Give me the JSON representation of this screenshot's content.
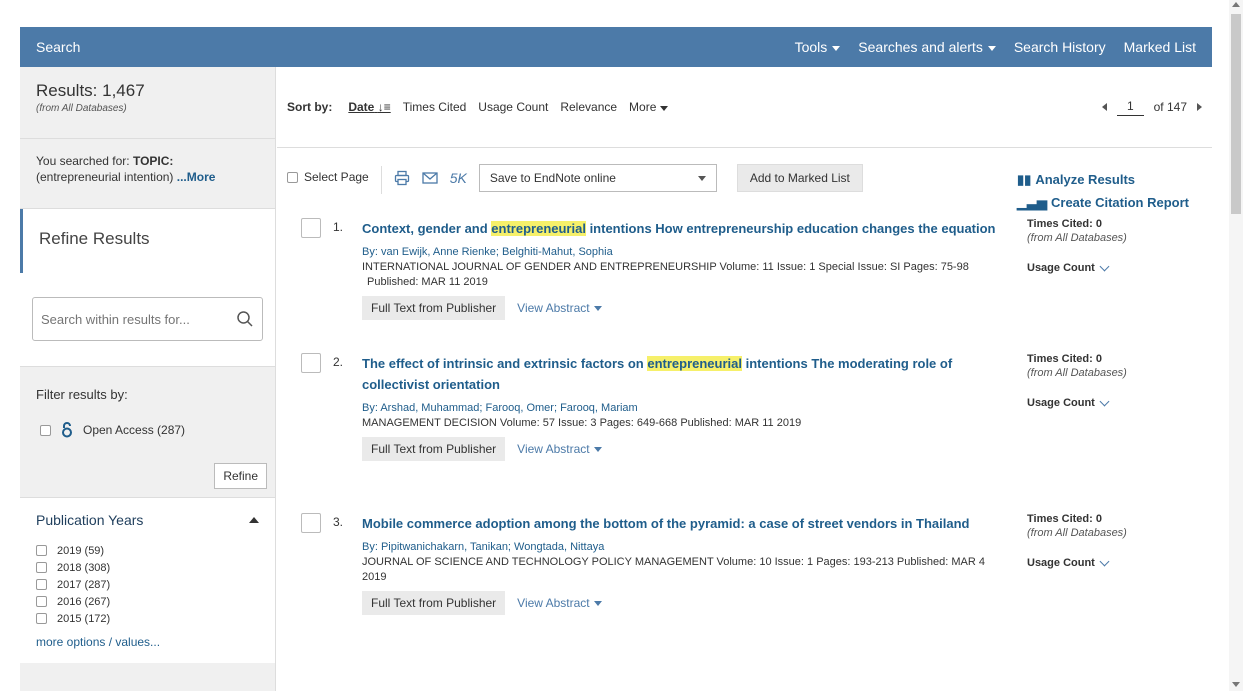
{
  "header": {
    "title": "Search",
    "menu": {
      "tools": "Tools",
      "searches_alerts": "Searches and alerts",
      "search_history": "Search History",
      "marked_list": "Marked List"
    }
  },
  "sidebar": {
    "results": "Results: 1,467",
    "results_sub": "(from All Databases)",
    "searched_prefix": "You searched for:",
    "searched_topic_label": "TOPIC:",
    "searched_query": "(entrepreneurial intention)",
    "more_link": "...More",
    "refine_title": "Refine Results",
    "search_placeholder": "Search within results for...",
    "filter_title": "Filter results by:",
    "open_access": "Open Access (287)",
    "refine_button": "Refine",
    "pub_years_title": "Publication Years",
    "years": [
      {
        "label": "2019 (59)"
      },
      {
        "label": "2018 (308)"
      },
      {
        "label": "2017 (287)"
      },
      {
        "label": "2016 (267)"
      },
      {
        "label": "2015 (172)"
      }
    ],
    "more_options": "more options / values..."
  },
  "sortbar": {
    "label": "Sort by:",
    "date": "Date",
    "times_cited": "Times Cited",
    "usage_count": "Usage Count",
    "relevance": "Relevance",
    "more": "More",
    "page": "1",
    "of_pages": "of 147"
  },
  "toolbar": {
    "select_page": "Select Page",
    "five_k": "5K",
    "endnote": "Save to EndNote online",
    "add_marked": "Add to Marked List",
    "analyze": "Analyze Results",
    "citation_report": "Create Citation Report"
  },
  "records": [
    {
      "num": "1.",
      "title_pre": "Context, gender and ",
      "title_hl": "entrepreneurial",
      "title_post": " intentions How entrepreneurship education changes the equation",
      "authors": "By: van Ewijk, Anne Rienke; Belghiti-Mahut, Sophia",
      "source": "INTERNATIONAL JOURNAL OF GENDER AND ENTREPRENEURSHIP  Volume: 11  Issue: 1  Special Issue: SI  Pages: 75-98",
      "published": "Published: MAR 11 2019",
      "full_text": "Full Text from Publisher",
      "view_abstract": "View Abstract",
      "times_cited": "Times Cited: 0",
      "from_db": "(from All Databases)",
      "usage": "Usage Count"
    },
    {
      "num": "2.",
      "title_pre": "The effect of intrinsic and extrinsic factors on ",
      "title_hl": "entrepreneurial",
      "title_post": " intentions The moderating role of collectivist orientation",
      "authors": "By: Arshad, Muhammad; Farooq, Omer; Farooq, Mariam",
      "source": "MANAGEMENT DECISION  Volume: 57  Issue: 3  Pages: 649-668  Published: MAR 11 2019",
      "published": "",
      "full_text": "Full Text from Publisher",
      "view_abstract": "View Abstract",
      "times_cited": "Times Cited: 0",
      "from_db": "(from All Databases)",
      "usage": "Usage Count"
    },
    {
      "num": "3.",
      "title_pre": "Mobile commerce adoption among the bottom of the pyramid: a case of street vendors in Thailand",
      "title_hl": "",
      "title_post": "",
      "authors": "By: Pipitwanichakarn, Tanikan; Wongtada, Nittaya",
      "source": "JOURNAL OF SCIENCE AND TECHNOLOGY POLICY MANAGEMENT  Volume: 10  Issue: 1  Pages: 193-213  Published: MAR 4 2019",
      "published": "",
      "full_text": "Full Text from Publisher",
      "view_abstract": "View Abstract",
      "times_cited": "Times Cited: 0",
      "from_db": "(from All Databases)",
      "usage": "Usage Count"
    }
  ]
}
